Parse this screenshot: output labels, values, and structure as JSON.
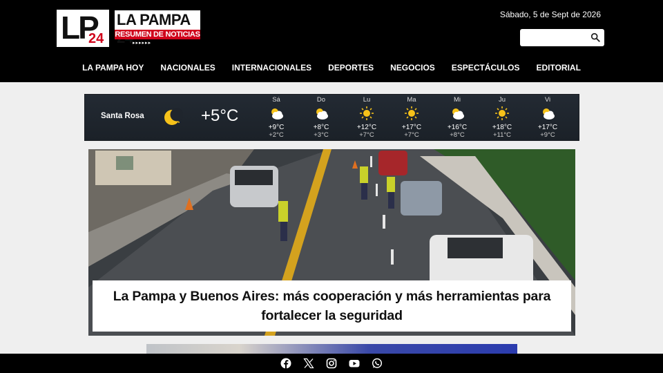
{
  "site": {
    "logo_lp": "LP",
    "logo_num": "24",
    "logo_title": "LA PAMPA 24",
    "logo_subtitle": "RESUMEN DE NOTICIAS",
    "logo_arrows": "▸▸▸▸▸▸"
  },
  "header": {
    "date": "Sábado, 5 de Sept de 2026",
    "search_placeholder": "",
    "search_icon": "search-icon"
  },
  "nav": {
    "items": [
      "LA PAMPA HOY",
      "NACIONALES",
      "INTERNACIONALES",
      "DEPORTES",
      "NEGOCIOS",
      "ESPECTÁCULOS",
      "EDITORIAL"
    ]
  },
  "weather": {
    "city": "Santa Rosa",
    "current_icon": "moon-icon",
    "current_temp": "+5°C",
    "days": [
      {
        "name": "Sá",
        "icon": "partly-cloudy-icon",
        "hi": "+9°C",
        "lo": "+2°C"
      },
      {
        "name": "Do",
        "icon": "partly-cloudy-icon",
        "hi": "+8°C",
        "lo": "+3°C"
      },
      {
        "name": "Lu",
        "icon": "sun-icon",
        "hi": "+12°C",
        "lo": "+7°C"
      },
      {
        "name": "Ma",
        "icon": "sun-icon",
        "hi": "+17°C",
        "lo": "+7°C"
      },
      {
        "name": "Mi",
        "icon": "partly-cloudy-icon",
        "hi": "+16°C",
        "lo": "+8°C"
      },
      {
        "name": "Ju",
        "icon": "sun-icon",
        "hi": "+18°C",
        "lo": "+11°C"
      },
      {
        "name": "Vi",
        "icon": "partly-cloudy-icon",
        "hi": "+17°C",
        "lo": "+9°C"
      }
    ]
  },
  "hero": {
    "headline": "La Pampa y Buenos Aires: más cooperación y más herramientas para fortalecer la seguridad"
  },
  "footer": {
    "social": [
      "facebook-icon",
      "x-icon",
      "instagram-icon",
      "youtube-icon",
      "whatsapp-icon"
    ]
  },
  "colors": {
    "header_bg": "#000000",
    "brand_red": "#d0021b",
    "page_bg": "#efefef",
    "weather_bg": "#1f252d"
  }
}
